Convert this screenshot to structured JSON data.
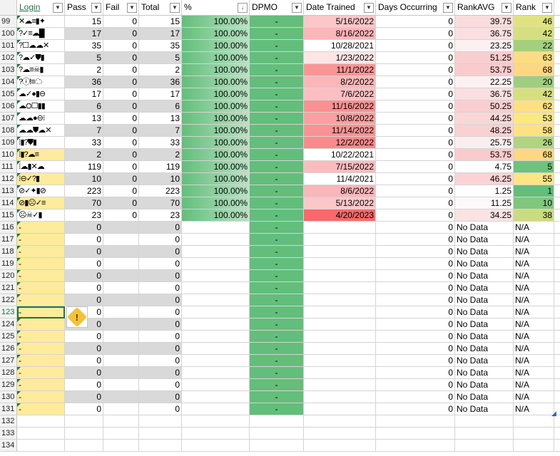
{
  "headers": {
    "login": "Login",
    "pass": "Pass",
    "fail": "Fail",
    "total": "Total",
    "pct": "%",
    "dpmo": "DPMO",
    "date": "Date Trained",
    "days": "Days Occurring",
    "rankavg": "RankAVG",
    "rank": "Rank",
    "filter_icon": "filter-dropdown-icon",
    "sorted_filter_icon": "sort-descending-filter-icon"
  },
  "colors": {
    "green_fill": "#63be7b",
    "yellow_login": "#ffeb9c",
    "red_strong": "#f8696b",
    "red_light": "#fcd8d9",
    "rank_green": "#63be7b",
    "rank_yellow": "#ffe984"
  },
  "rows": [
    {
      "rn": "99",
      "icons": "✕☁≡▮✦",
      "pass": "15",
      "fail": "0",
      "total": "15",
      "pct": "100.00%",
      "dpmo": "-",
      "date": "5/16/2022",
      "date_color": "#fbc7c9",
      "days": "0",
      "rankavg": "39.75",
      "rankavg_color": "#fbdcdd",
      "rank": "46",
      "rank_color": "#e0e282"
    },
    {
      "rn": "100",
      "icons": "?✓≡☁█",
      "pass": "17",
      "fail": "0",
      "total": "17",
      "pct": "100.00%",
      "dpmo": "-",
      "date": "8/16/2022",
      "date_color": "#fab6b8",
      "days": "0",
      "rankavg": "36.75",
      "rankavg_color": "#fbdfe0",
      "rank": "42",
      "rank_color": "#d6df80"
    },
    {
      "rn": "101",
      "icons": "?☐☁☁✕",
      "pass": "35",
      "fail": "0",
      "total": "35",
      "pct": "100.00%",
      "dpmo": "-",
      "date": "10/28/2021",
      "date_color": "#ffffff",
      "days": "0",
      "rankavg": "23.25",
      "rankavg_color": "#fcf0f1",
      "rank": "22",
      "rank_color": "#a4d07e"
    },
    {
      "rn": "102",
      "icons": "?☁✓⛊▮",
      "pass": "5",
      "fail": "0",
      "total": "5",
      "pct": "100.00%",
      "dpmo": "-",
      "date": "1/23/2022",
      "date_color": "#fde5e6",
      "days": "0",
      "rankavg": "51.25",
      "rankavg_color": "#facdcf",
      "rank": "63",
      "rank_color": "#fedd82"
    },
    {
      "rn": "103",
      "icons": "?☁≡☠▮",
      "pass": "2",
      "fail": "0",
      "total": "2",
      "pct": "100.00%",
      "dpmo": "-",
      "date": "11/1/2022",
      "date_color": "#f99597",
      "days": "0",
      "rankavg": "53.75",
      "rankavg_color": "#facbcd",
      "rank": "68",
      "rank_color": "#fed782"
    },
    {
      "rn": "104",
      "icons": "?ⓘ!≡☁",
      "pass": "36",
      "fail": "0",
      "total": "36",
      "pct": "100.00%",
      "dpmo": "-",
      "date": "8/2/2022",
      "date_color": "#fab7b9",
      "days": "0",
      "rankavg": "22.25",
      "rankavg_color": "#fcf1f2",
      "rank": "20",
      "rank_color": "#9fcf7e"
    },
    {
      "rn": "105",
      "icons": "☁✓●▮⊖",
      "pass": "17",
      "fail": "0",
      "total": "17",
      "pct": "100.00%",
      "dpmo": "-",
      "date": "7/6/2022",
      "date_color": "#fbbfc1",
      "days": "0",
      "rankavg": "36.75",
      "rankavg_color": "#fbdfe0",
      "rank": "42",
      "rank_color": "#d6df80"
    },
    {
      "rn": "106",
      "icons": "☁⛭☐▮▮",
      "pass": "6",
      "fail": "0",
      "total": "6",
      "pct": "100.00%",
      "dpmo": "-",
      "date": "11/16/2022",
      "date_color": "#f99193",
      "days": "0",
      "rankavg": "50.25",
      "rankavg_color": "#faced0",
      "rank": "62",
      "rank_color": "#fee082"
    },
    {
      "rn": "107",
      "icons": "☁☁●⊖⁝",
      "pass": "13",
      "fail": "0",
      "total": "13",
      "pct": "100.00%",
      "dpmo": "-",
      "date": "10/8/2022",
      "date_color": "#f9a0a2",
      "days": "0",
      "rankavg": "44.25",
      "rankavg_color": "#fbd6d7",
      "rank": "53",
      "rank_color": "#fbe783"
    },
    {
      "rn": "108",
      "icons": "☁☁⛊☁✕",
      "pass": "7",
      "fail": "0",
      "total": "7",
      "pct": "100.00%",
      "dpmo": "-",
      "date": "11/14/2022",
      "date_color": "#f99294",
      "days": "0",
      "rankavg": "48.25",
      "rankavg_color": "#fad1d3",
      "rank": "58",
      "rank_color": "#fee282"
    },
    {
      "rn": "109",
      "icons": "⁝▮?⛊▮",
      "pass": "33",
      "fail": "0",
      "total": "33",
      "pct": "100.00%",
      "dpmo": "-",
      "date": "12/2/2022",
      "date_color": "#f88a8c",
      "days": "0",
      "rankavg": "25.75",
      "rankavg_color": "#fcedee",
      "rank": "26",
      "rank_color": "#b0d47f"
    },
    {
      "rn": "110",
      "icons": "⁝▮?☁≡",
      "pass": "2",
      "fail": "0",
      "total": "2",
      "pct": "100.00%",
      "dpmo": "-",
      "date": "10/22/2021",
      "date_color": "#ffffff",
      "days": "0",
      "rankavg": "53.75",
      "rankavg_color": "#facbcd",
      "rank": "68",
      "rank_color": "#fed782"
    },
    {
      "rn": "111",
      "icons": "⁝☁▮✕☁",
      "pass": "119",
      "fail": "0",
      "total": "119",
      "pct": "100.00%",
      "dpmo": "-",
      "date": "7/15/2022",
      "date_color": "#fbbcbe",
      "days": "0",
      "rankavg": "4.75",
      "rankavg_color": "#fefefe",
      "rank": "5",
      "rank_color": "#6fc27c"
    },
    {
      "rn": "112",
      "icons": "⁝⊖✓?▮",
      "pass": "10",
      "fail": "0",
      "total": "10",
      "pct": "100.00%",
      "dpmo": "-",
      "date": "11/4/2021",
      "date_color": "#ffffff",
      "days": "0",
      "rankavg": "46.25",
      "rankavg_color": "#fbd3d5",
      "rank": "55",
      "rank_color": "#fde583"
    },
    {
      "rn": "113",
      "icons": "⊘✓✦▮⊘",
      "pass": "223",
      "fail": "0",
      "total": "223",
      "pct": "100.00%",
      "dpmo": "-",
      "date": "8/6/2022",
      "date_color": "#fab6b8",
      "days": "0",
      "rankavg": "1.25",
      "rankavg_color": "#ffffff",
      "rank": "1",
      "rank_color": "#63be7b"
    },
    {
      "rn": "114",
      "icons": "⊘▮☹✓≡",
      "pass": "70",
      "fail": "0",
      "total": "70",
      "pct": "100.00%",
      "dpmo": "-",
      "date": "5/13/2022",
      "date_color": "#fbc8ca",
      "days": "0",
      "rankavg": "11.25",
      "rankavg_color": "#fdf9fa",
      "rank": "10",
      "rank_color": "#80c77d"
    },
    {
      "rn": "115",
      "icons": "☹☠✓▮",
      "pass": "23",
      "fail": "0",
      "total": "23",
      "pct": "100.00%",
      "dpmo": "-",
      "date": "4/20/2023",
      "date_color": "#f8696b",
      "days": "0",
      "rankavg": "34.25",
      "rankavg_color": "#fbe2e3",
      "rank": "38",
      "rank_color": "#cbdc80"
    }
  ],
  "empty_rows": [
    "116",
    "117",
    "118",
    "119",
    "120",
    "121",
    "122",
    "123",
    "124",
    "125",
    "126",
    "127",
    "128",
    "129",
    "130",
    "131"
  ],
  "empty_values": {
    "login": "-",
    "pass": "0",
    "total": "0",
    "dpmo": "-",
    "days": "0",
    "rankavg": "No Data",
    "rank": "N/A"
  },
  "trailing_rows": [
    "132",
    "133",
    "134"
  ],
  "warning_icon": "warning-diamond-icon",
  "warning_glyph": "!"
}
